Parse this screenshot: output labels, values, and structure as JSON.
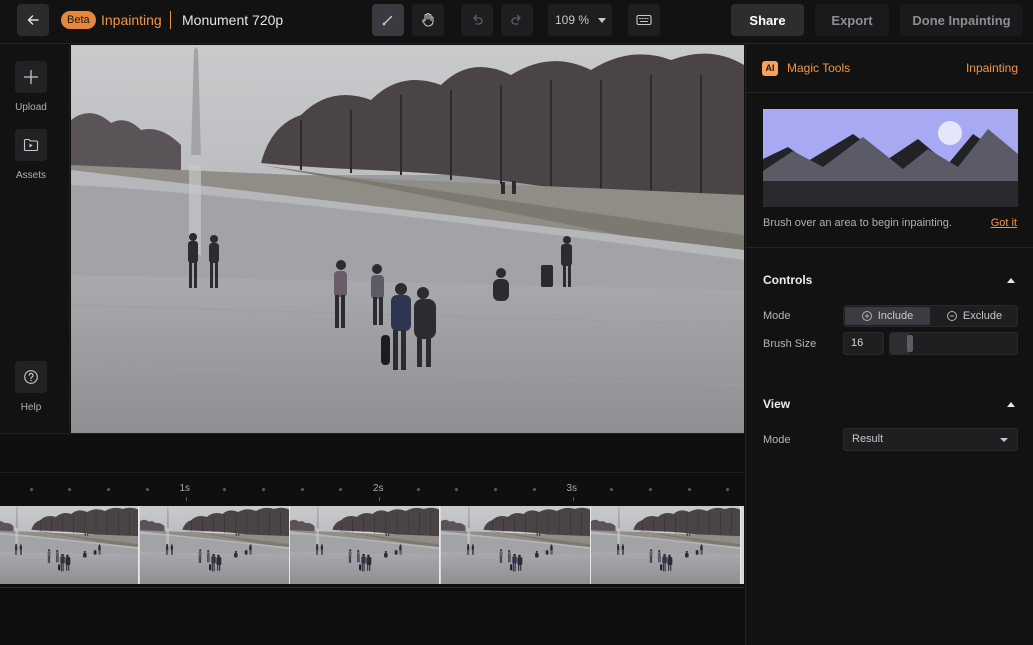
{
  "topbar": {
    "beta_badge": "Beta",
    "mode_title": "Inpainting",
    "project_title": "Monument 720p",
    "zoom_value": "109 %",
    "share_label": "Share",
    "export_label": "Export",
    "done_label": "Done Inpainting"
  },
  "sidebar": {
    "items": [
      {
        "label": "Upload",
        "icon": "plus-icon"
      },
      {
        "label": "Assets",
        "icon": "folder-play-icon"
      },
      {
        "label": "Help",
        "icon": "help-icon"
      }
    ]
  },
  "timeline": {
    "ticks": [
      "1s",
      "2s",
      "3s"
    ]
  },
  "panel": {
    "ai_badge": "AI",
    "title": "Magic Tools",
    "mode": "Inpainting",
    "hint": "Brush over an area to begin inpainting.",
    "got_it": "Got it",
    "controls": {
      "title": "Controls",
      "mode_label": "Mode",
      "include_label": "Include",
      "exclude_label": "Exclude",
      "selected_mode": "Include",
      "brush_size_label": "Brush Size",
      "brush_size_value": "16",
      "brush_size_fraction": 0.12
    },
    "view": {
      "title": "View",
      "mode_label": "Mode",
      "mode_value": "Result"
    }
  },
  "colors": {
    "accent": "#f0964a",
    "background": "#0f0f10",
    "panel": "#121213"
  }
}
